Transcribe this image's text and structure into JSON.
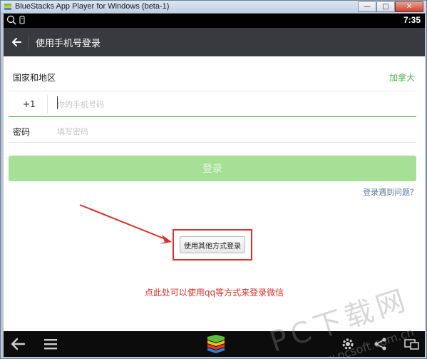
{
  "window": {
    "title": "BlueStacks App Player for Windows (beta-1)",
    "minimize_glyph": "—",
    "maximize_glyph": "□",
    "close_glyph": "✕"
  },
  "statusbar": {
    "time": "7:35"
  },
  "appbar": {
    "title": "使用手机号登录"
  },
  "form": {
    "country_label": "国家和地区",
    "country_value": "加拿大",
    "country_code": "+1",
    "phone_placeholder": "你的手机号码",
    "password_label": "密码",
    "password_placeholder": "填写密码",
    "login_label": "登录"
  },
  "links": {
    "trouble": "登录遇到问题？"
  },
  "other_login": {
    "label": "使用其他方式登录"
  },
  "annotation": {
    "hint": "点此处可以使用qq等方式来登录微信"
  },
  "navbar": {
    "icons": [
      "back-icon",
      "menu-icon",
      "bluestacks-logo-icon",
      "settings-icon",
      "share-icon",
      "screen-rotate-icon"
    ]
  },
  "watermark": {
    "text": "PC下载网",
    "url": "www.pcsoft.com.cn"
  },
  "colors": {
    "accent_green": "#48b548",
    "login_button": "#a5e096",
    "annotation_red": "#d9302c",
    "appbar": "#393a3f"
  }
}
